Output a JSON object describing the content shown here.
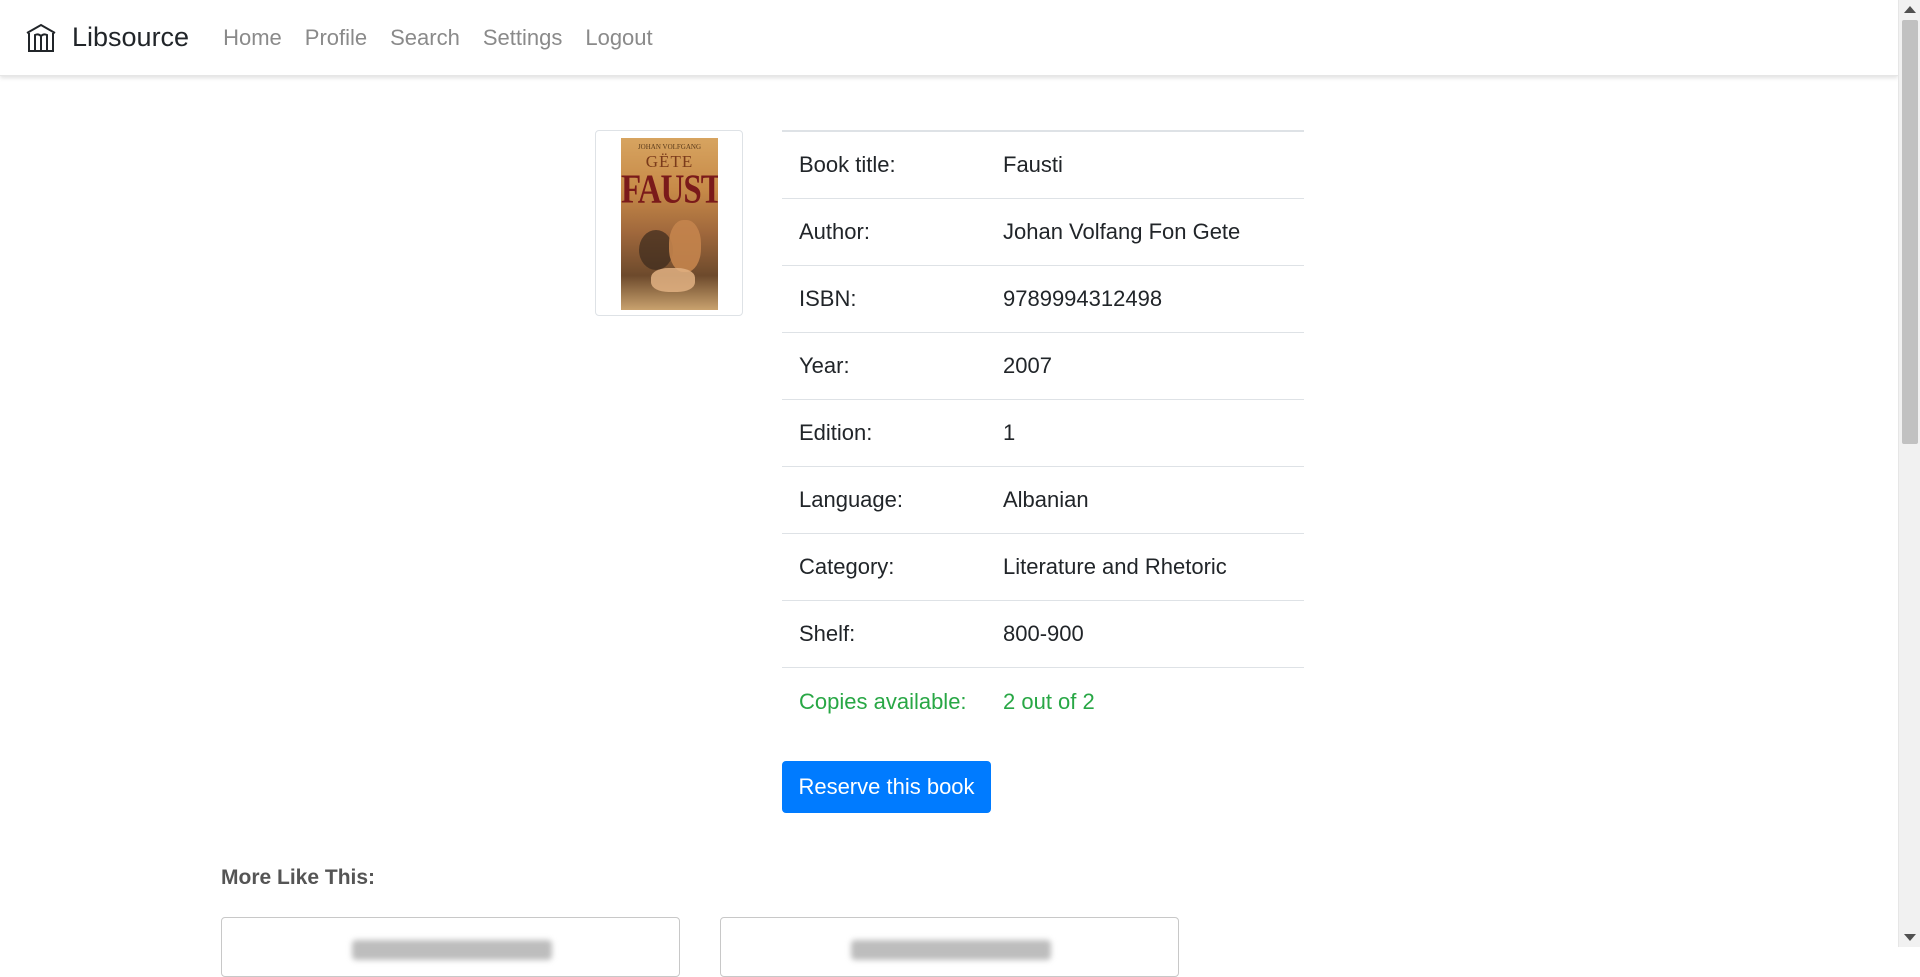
{
  "navbar": {
    "brand": "Libsource",
    "brand_icon": "library-icon",
    "links": [
      "Home",
      "Profile",
      "Search",
      "Settings",
      "Logout"
    ]
  },
  "cover": {
    "author_small": "JOHAN VOLFGANG",
    "author_large": "GËTE",
    "title": "FAUSTI"
  },
  "details": [
    {
      "label": "Book title:",
      "value": "Fausti"
    },
    {
      "label": "Author:",
      "value": "Johan Volfang Fon Gete"
    },
    {
      "label": "ISBN:",
      "value": "9789994312498"
    },
    {
      "label": "Year:",
      "value": "2007"
    },
    {
      "label": "Edition:",
      "value": "1"
    },
    {
      "label": "Language:",
      "value": "Albanian"
    },
    {
      "label": "Category:",
      "value": "Literature and Rhetoric"
    },
    {
      "label": "Shelf:",
      "value": "800-900"
    },
    {
      "label": "Copies available:",
      "value": "2 out of 2"
    }
  ],
  "reserve_button": "Reserve this book",
  "more_heading": "More Like This:",
  "colors": {
    "primary": "#007bff",
    "available": "#28a745",
    "nav_link": "#8a8a8a"
  }
}
